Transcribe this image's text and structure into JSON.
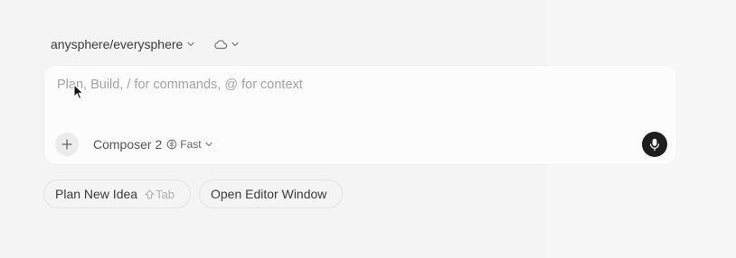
{
  "header": {
    "repo_label": "anysphere/everysphere",
    "repo_chevron_icon": "chevron-down-icon",
    "cloud_icon": "cloud-icon",
    "cloud_chevron_icon": "chevron-down-icon"
  },
  "composer": {
    "placeholder": "Plan, Build, / for commands, @ for context",
    "value": "",
    "add_icon": "plus-icon",
    "model_label": "Composer 2",
    "speed_icon": "brain-icon",
    "speed_label": "Fast",
    "speed_chevron_icon": "chevron-down-icon",
    "mic_icon": "microphone-icon"
  },
  "suggestions": [
    {
      "label": "Plan New Idea",
      "shortcut_icon": "shift-icon",
      "shortcut": "Tab"
    },
    {
      "label": "Open Editor Window"
    }
  ],
  "colors": {
    "background": "#f4f4f4",
    "composer_background": "#fcfcfc",
    "mic_button": "#1e1e1e",
    "placeholder": "#a3a3a3"
  }
}
